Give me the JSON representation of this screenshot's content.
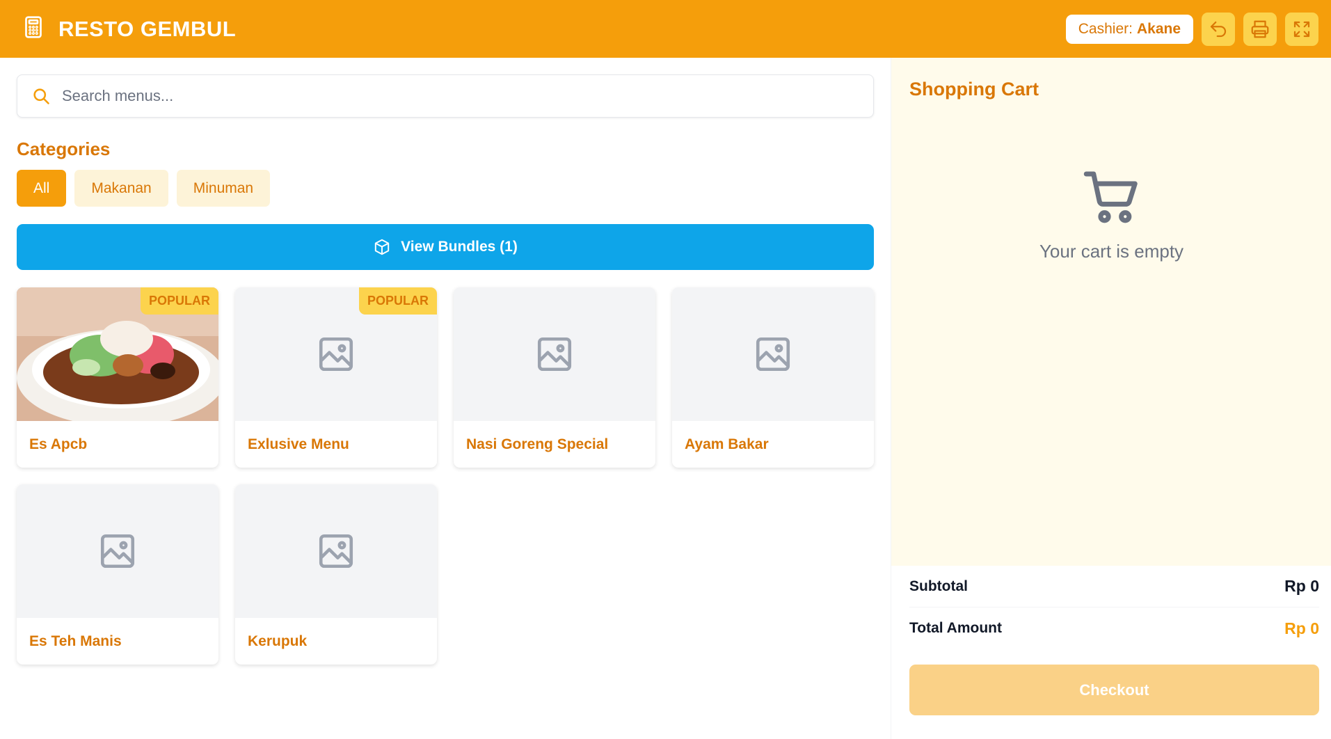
{
  "header": {
    "brand": "RESTO GEMBUL",
    "cashier_label": "Cashier:",
    "cashier_name": "Akane",
    "brand_color": "#f59e0b",
    "actions": [
      {
        "icon": "undo-icon"
      },
      {
        "icon": "printer-icon"
      },
      {
        "icon": "fullscreen-icon"
      }
    ]
  },
  "search": {
    "placeholder": "Search menus..."
  },
  "categories": {
    "title": "Categories",
    "items": [
      {
        "label": "All",
        "active": true
      },
      {
        "label": "Makanan",
        "active": false
      },
      {
        "label": "Minuman",
        "active": false
      }
    ]
  },
  "bundles": {
    "label": "View Bundles (1)",
    "icon": "package-icon",
    "color": "#0ea5e9"
  },
  "menu": {
    "items": [
      {
        "name": "Es Apcb",
        "badge": "POPULAR",
        "image": "photo"
      },
      {
        "name": "Exlusive Menu",
        "badge": "POPULAR",
        "image": "placeholder"
      },
      {
        "name": "Nasi Goreng Special",
        "badge": "",
        "image": "placeholder"
      },
      {
        "name": "Ayam Bakar",
        "badge": "",
        "image": "placeholder"
      },
      {
        "name": "Es Teh Manis",
        "badge": "",
        "image": "placeholder"
      },
      {
        "name": "Kerupuk",
        "badge": "",
        "image": "placeholder"
      }
    ]
  },
  "cart": {
    "title": "Shopping Cart",
    "empty_text": "Your cart is empty",
    "subtotal_label": "Subtotal",
    "subtotal_value": "Rp 0",
    "total_label": "Total Amount",
    "total_value": "Rp 0",
    "checkout_label": "Checkout"
  }
}
